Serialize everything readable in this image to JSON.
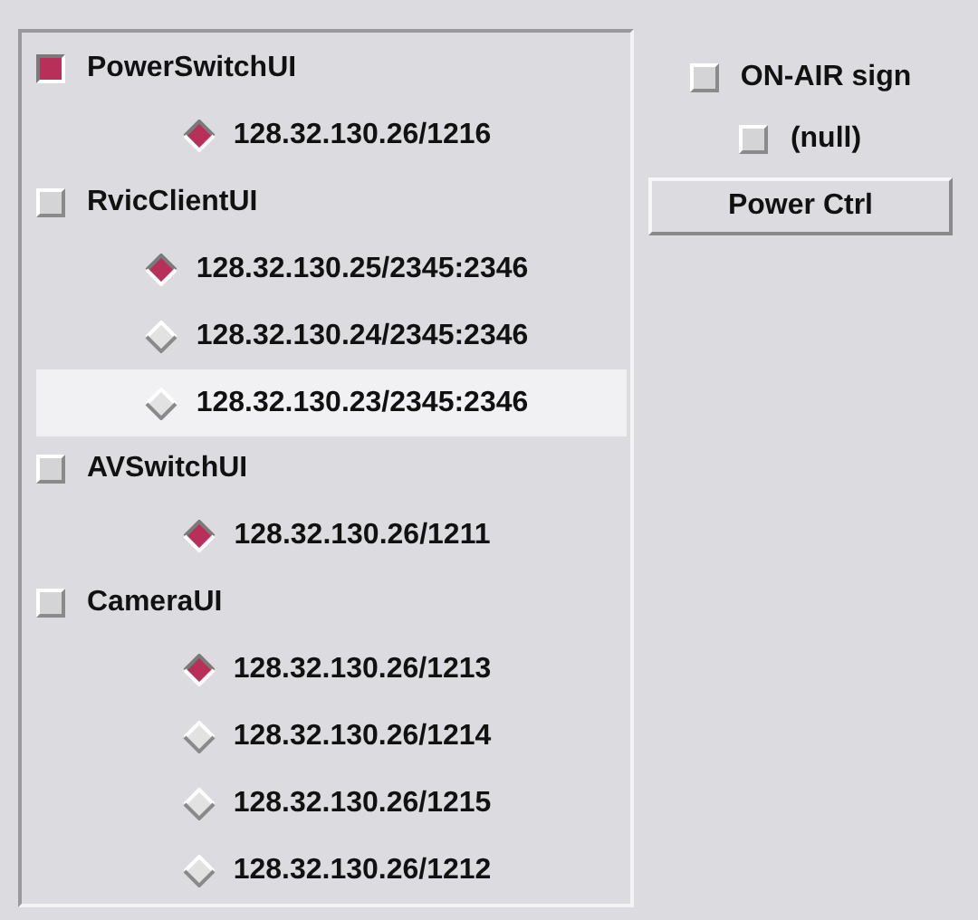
{
  "groups": [
    {
      "label": "PowerSwitchUI",
      "checked": true,
      "children": [
        {
          "label": "128.32.130.26/1216",
          "selected": true,
          "highlighted": false
        }
      ]
    },
    {
      "label": "RvicClientUI",
      "checked": false,
      "children": [
        {
          "label": "128.32.130.25/2345:2346",
          "selected": true,
          "highlighted": false
        },
        {
          "label": "128.32.130.24/2345:2346",
          "selected": false,
          "highlighted": false
        },
        {
          "label": "128.32.130.23/2345:2346",
          "selected": false,
          "highlighted": true
        }
      ]
    },
    {
      "label": "AVSwitchUI",
      "checked": false,
      "children": [
        {
          "label": "128.32.130.26/1211",
          "selected": true,
          "highlighted": false
        }
      ]
    },
    {
      "label": "CameraUI",
      "checked": false,
      "children": [
        {
          "label": "128.32.130.26/1213",
          "selected": true,
          "highlighted": false
        },
        {
          "label": "128.32.130.26/1214",
          "selected": false,
          "highlighted": false
        },
        {
          "label": "128.32.130.26/1215",
          "selected": false,
          "highlighted": false
        },
        {
          "label": "128.32.130.26/1212",
          "selected": false,
          "highlighted": false
        }
      ]
    }
  ],
  "side_checks": [
    {
      "label": "ON-AIR sign",
      "checked": false
    },
    {
      "label": "(null)",
      "checked": false
    }
  ],
  "button": "Power Ctrl"
}
